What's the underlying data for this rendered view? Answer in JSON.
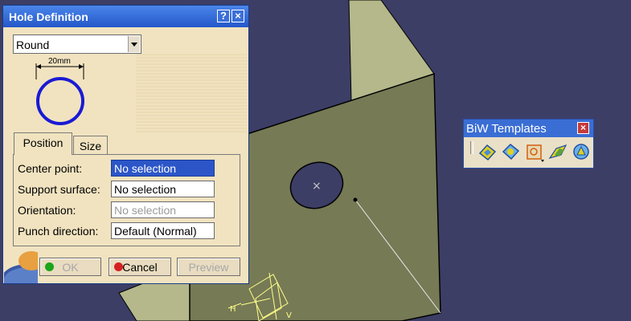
{
  "dialog": {
    "title": "Hole Definition",
    "help_glyph": "?",
    "close_glyph": "×",
    "shape_select": {
      "value": "Round"
    },
    "diagram_dimension": "20mm",
    "tabs": [
      {
        "label": "Position",
        "active": true
      },
      {
        "label": "Size",
        "active": false
      }
    ],
    "fields": [
      {
        "label": "Center point:",
        "value": "No selection",
        "state": "selected"
      },
      {
        "label": "Support surface:",
        "value": "No selection",
        "state": "normal"
      },
      {
        "label": "Orientation:",
        "value": "No selection",
        "state": "disabled"
      },
      {
        "label": "Punch direction:",
        "value": "Default (Normal)",
        "state": "normal"
      }
    ],
    "buttons": {
      "ok": {
        "label": "OK",
        "enabled": false,
        "indicator_color": "#1aa51a"
      },
      "cancel": {
        "label": "Cancel",
        "enabled": true,
        "indicator_color": "#d62020"
      },
      "preview": {
        "label": "Preview",
        "enabled": false
      }
    }
  },
  "toolbar": {
    "title": "BiW Templates",
    "close_glyph": "×",
    "icons": [
      "template-icon-1",
      "template-icon-2",
      "hole-icon",
      "template-icon-4",
      "template-icon-5"
    ]
  },
  "viewport": {
    "background": "#3c3e66",
    "part_color": "#767a55",
    "flange_color": "#b4b88a",
    "axis_labels": [
      "H",
      "V"
    ]
  }
}
